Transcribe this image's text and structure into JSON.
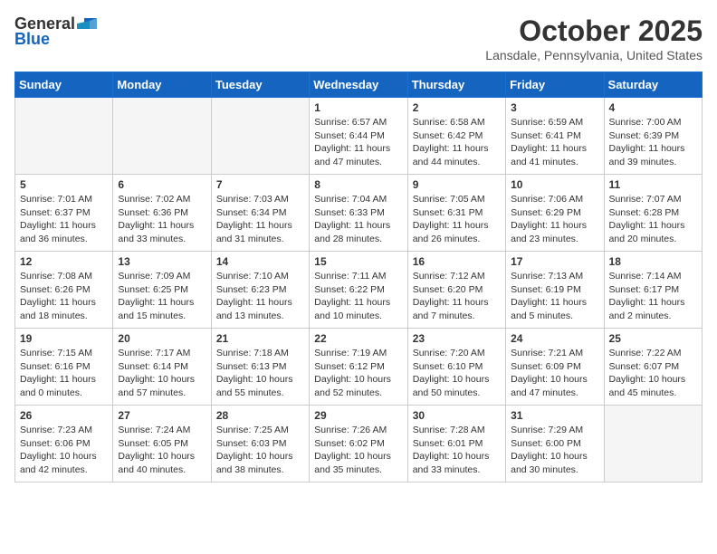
{
  "logo": {
    "general": "General",
    "blue": "Blue"
  },
  "title": "October 2025",
  "location": "Lansdale, Pennsylvania, United States",
  "days_of_week": [
    "Sunday",
    "Monday",
    "Tuesday",
    "Wednesday",
    "Thursday",
    "Friday",
    "Saturday"
  ],
  "weeks": [
    [
      {
        "day": "",
        "info": ""
      },
      {
        "day": "",
        "info": ""
      },
      {
        "day": "",
        "info": ""
      },
      {
        "day": "1",
        "info": "Sunrise: 6:57 AM\nSunset: 6:44 PM\nDaylight: 11 hours and 47 minutes."
      },
      {
        "day": "2",
        "info": "Sunrise: 6:58 AM\nSunset: 6:42 PM\nDaylight: 11 hours and 44 minutes."
      },
      {
        "day": "3",
        "info": "Sunrise: 6:59 AM\nSunset: 6:41 PM\nDaylight: 11 hours and 41 minutes."
      },
      {
        "day": "4",
        "info": "Sunrise: 7:00 AM\nSunset: 6:39 PM\nDaylight: 11 hours and 39 minutes."
      }
    ],
    [
      {
        "day": "5",
        "info": "Sunrise: 7:01 AM\nSunset: 6:37 PM\nDaylight: 11 hours and 36 minutes."
      },
      {
        "day": "6",
        "info": "Sunrise: 7:02 AM\nSunset: 6:36 PM\nDaylight: 11 hours and 33 minutes."
      },
      {
        "day": "7",
        "info": "Sunrise: 7:03 AM\nSunset: 6:34 PM\nDaylight: 11 hours and 31 minutes."
      },
      {
        "day": "8",
        "info": "Sunrise: 7:04 AM\nSunset: 6:33 PM\nDaylight: 11 hours and 28 minutes."
      },
      {
        "day": "9",
        "info": "Sunrise: 7:05 AM\nSunset: 6:31 PM\nDaylight: 11 hours and 26 minutes."
      },
      {
        "day": "10",
        "info": "Sunrise: 7:06 AM\nSunset: 6:29 PM\nDaylight: 11 hours and 23 minutes."
      },
      {
        "day": "11",
        "info": "Sunrise: 7:07 AM\nSunset: 6:28 PM\nDaylight: 11 hours and 20 minutes."
      }
    ],
    [
      {
        "day": "12",
        "info": "Sunrise: 7:08 AM\nSunset: 6:26 PM\nDaylight: 11 hours and 18 minutes."
      },
      {
        "day": "13",
        "info": "Sunrise: 7:09 AM\nSunset: 6:25 PM\nDaylight: 11 hours and 15 minutes."
      },
      {
        "day": "14",
        "info": "Sunrise: 7:10 AM\nSunset: 6:23 PM\nDaylight: 11 hours and 13 minutes."
      },
      {
        "day": "15",
        "info": "Sunrise: 7:11 AM\nSunset: 6:22 PM\nDaylight: 11 hours and 10 minutes."
      },
      {
        "day": "16",
        "info": "Sunrise: 7:12 AM\nSunset: 6:20 PM\nDaylight: 11 hours and 7 minutes."
      },
      {
        "day": "17",
        "info": "Sunrise: 7:13 AM\nSunset: 6:19 PM\nDaylight: 11 hours and 5 minutes."
      },
      {
        "day": "18",
        "info": "Sunrise: 7:14 AM\nSunset: 6:17 PM\nDaylight: 11 hours and 2 minutes."
      }
    ],
    [
      {
        "day": "19",
        "info": "Sunrise: 7:15 AM\nSunset: 6:16 PM\nDaylight: 11 hours and 0 minutes."
      },
      {
        "day": "20",
        "info": "Sunrise: 7:17 AM\nSunset: 6:14 PM\nDaylight: 10 hours and 57 minutes."
      },
      {
        "day": "21",
        "info": "Sunrise: 7:18 AM\nSunset: 6:13 PM\nDaylight: 10 hours and 55 minutes."
      },
      {
        "day": "22",
        "info": "Sunrise: 7:19 AM\nSunset: 6:12 PM\nDaylight: 10 hours and 52 minutes."
      },
      {
        "day": "23",
        "info": "Sunrise: 7:20 AM\nSunset: 6:10 PM\nDaylight: 10 hours and 50 minutes."
      },
      {
        "day": "24",
        "info": "Sunrise: 7:21 AM\nSunset: 6:09 PM\nDaylight: 10 hours and 47 minutes."
      },
      {
        "day": "25",
        "info": "Sunrise: 7:22 AM\nSunset: 6:07 PM\nDaylight: 10 hours and 45 minutes."
      }
    ],
    [
      {
        "day": "26",
        "info": "Sunrise: 7:23 AM\nSunset: 6:06 PM\nDaylight: 10 hours and 42 minutes."
      },
      {
        "day": "27",
        "info": "Sunrise: 7:24 AM\nSunset: 6:05 PM\nDaylight: 10 hours and 40 minutes."
      },
      {
        "day": "28",
        "info": "Sunrise: 7:25 AM\nSunset: 6:03 PM\nDaylight: 10 hours and 38 minutes."
      },
      {
        "day": "29",
        "info": "Sunrise: 7:26 AM\nSunset: 6:02 PM\nDaylight: 10 hours and 35 minutes."
      },
      {
        "day": "30",
        "info": "Sunrise: 7:28 AM\nSunset: 6:01 PM\nDaylight: 10 hours and 33 minutes."
      },
      {
        "day": "31",
        "info": "Sunrise: 7:29 AM\nSunset: 6:00 PM\nDaylight: 10 hours and 30 minutes."
      },
      {
        "day": "",
        "info": ""
      }
    ]
  ]
}
